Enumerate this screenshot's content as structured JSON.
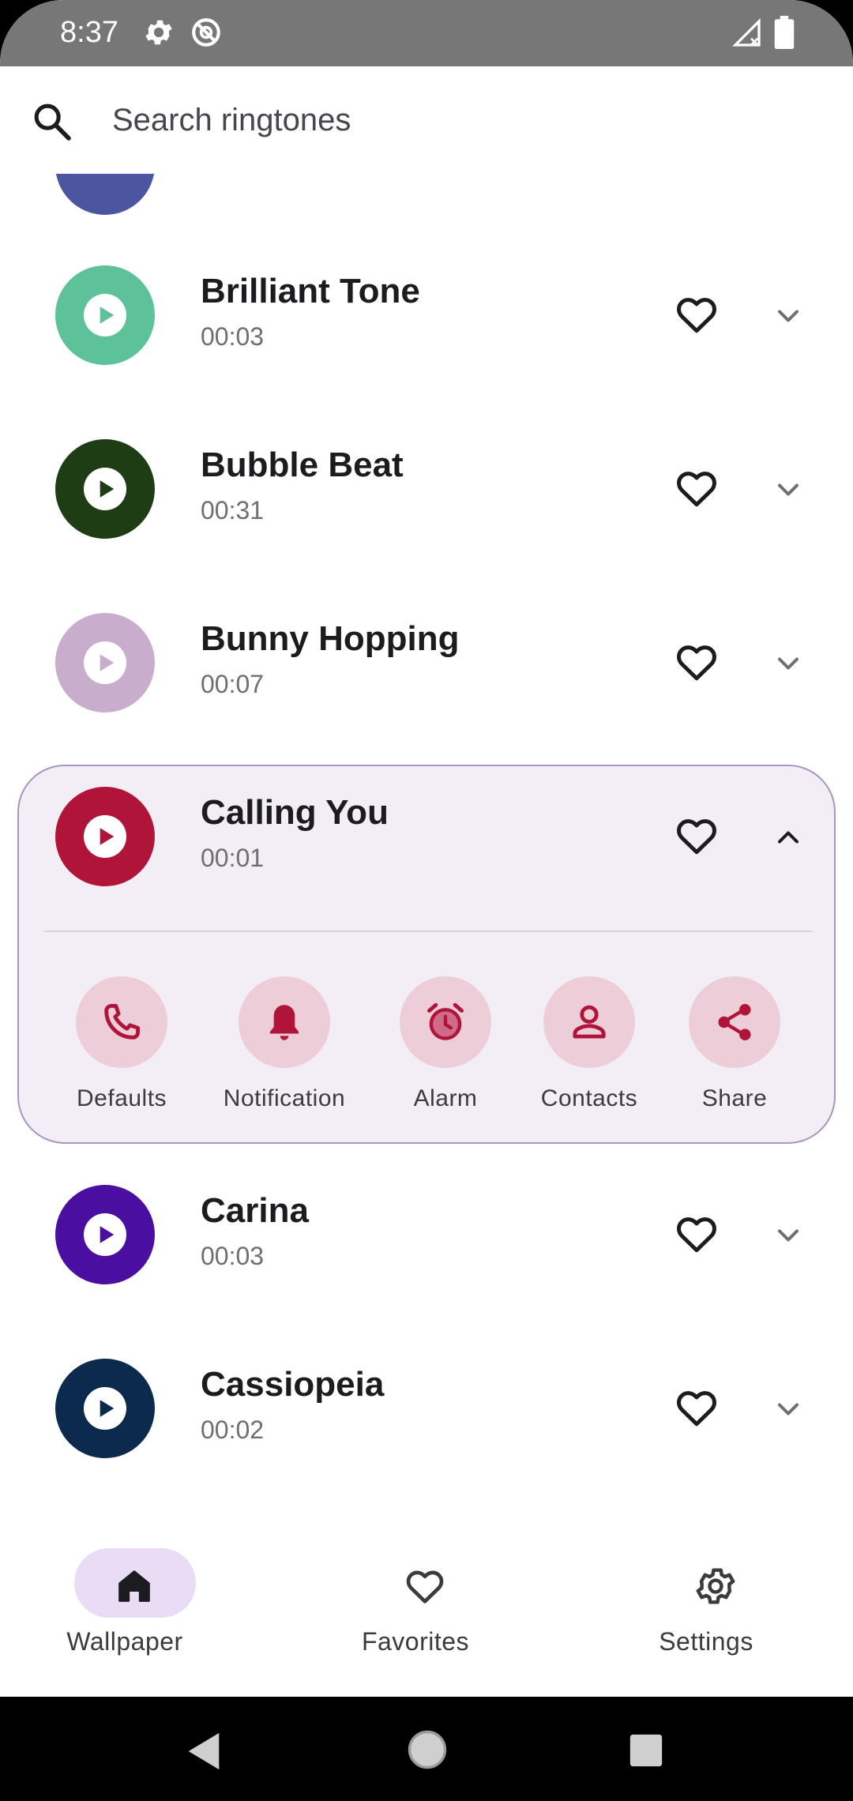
{
  "status_bar": {
    "time": "8:37"
  },
  "search": {
    "placeholder": "Search ringtones",
    "value": ""
  },
  "list": {
    "peek_item": {
      "color": "#4c55a0"
    },
    "items": [
      {
        "title": "Brilliant Tone",
        "duration": "00:03",
        "color": "#5dc199",
        "icon_color": "#5dc199",
        "expanded": false
      },
      {
        "title": "Bubble Beat",
        "duration": "00:31",
        "color": "#1f3d14",
        "icon_color": "#1f3d14",
        "expanded": false
      },
      {
        "title": "Bunny Hopping",
        "duration": "00:07",
        "color": "#c8aecc",
        "icon_color": "#c8aecc",
        "expanded": false
      },
      {
        "title": "Calling You",
        "duration": "00:01",
        "color": "#b01439",
        "icon_color": "#b01439",
        "expanded": true
      },
      {
        "title": "Carina",
        "duration": "00:03",
        "color": "#4a0fa0",
        "icon_color": "#4a0fa0",
        "expanded": false
      },
      {
        "title": "Cassiopeia",
        "duration": "00:02",
        "color": "#0c2a4e",
        "icon_color": "#0c2a4e",
        "expanded": false
      }
    ]
  },
  "expanded_actions": [
    {
      "label": "Defaults",
      "icon": "phone-icon"
    },
    {
      "label": "Notification",
      "icon": "bell-icon"
    },
    {
      "label": "Alarm",
      "icon": "alarm-clock-icon"
    },
    {
      "label": "Contacts",
      "icon": "person-icon"
    },
    {
      "label": "Share",
      "icon": "share-icon"
    }
  ],
  "bottom_nav": {
    "items": [
      {
        "label": "Wallpaper",
        "icon": "home-icon",
        "selected": true
      },
      {
        "label": "Favorites",
        "icon": "heart-outline-icon",
        "selected": false
      },
      {
        "label": "Settings",
        "icon": "gear-icon",
        "selected": false
      }
    ]
  },
  "colors": {
    "accent": "#b01439",
    "action_bg": "#eccdd8",
    "card_bg": "#f3eef5",
    "card_border": "#a594c4",
    "nav_pill": "#e9ddf5"
  }
}
